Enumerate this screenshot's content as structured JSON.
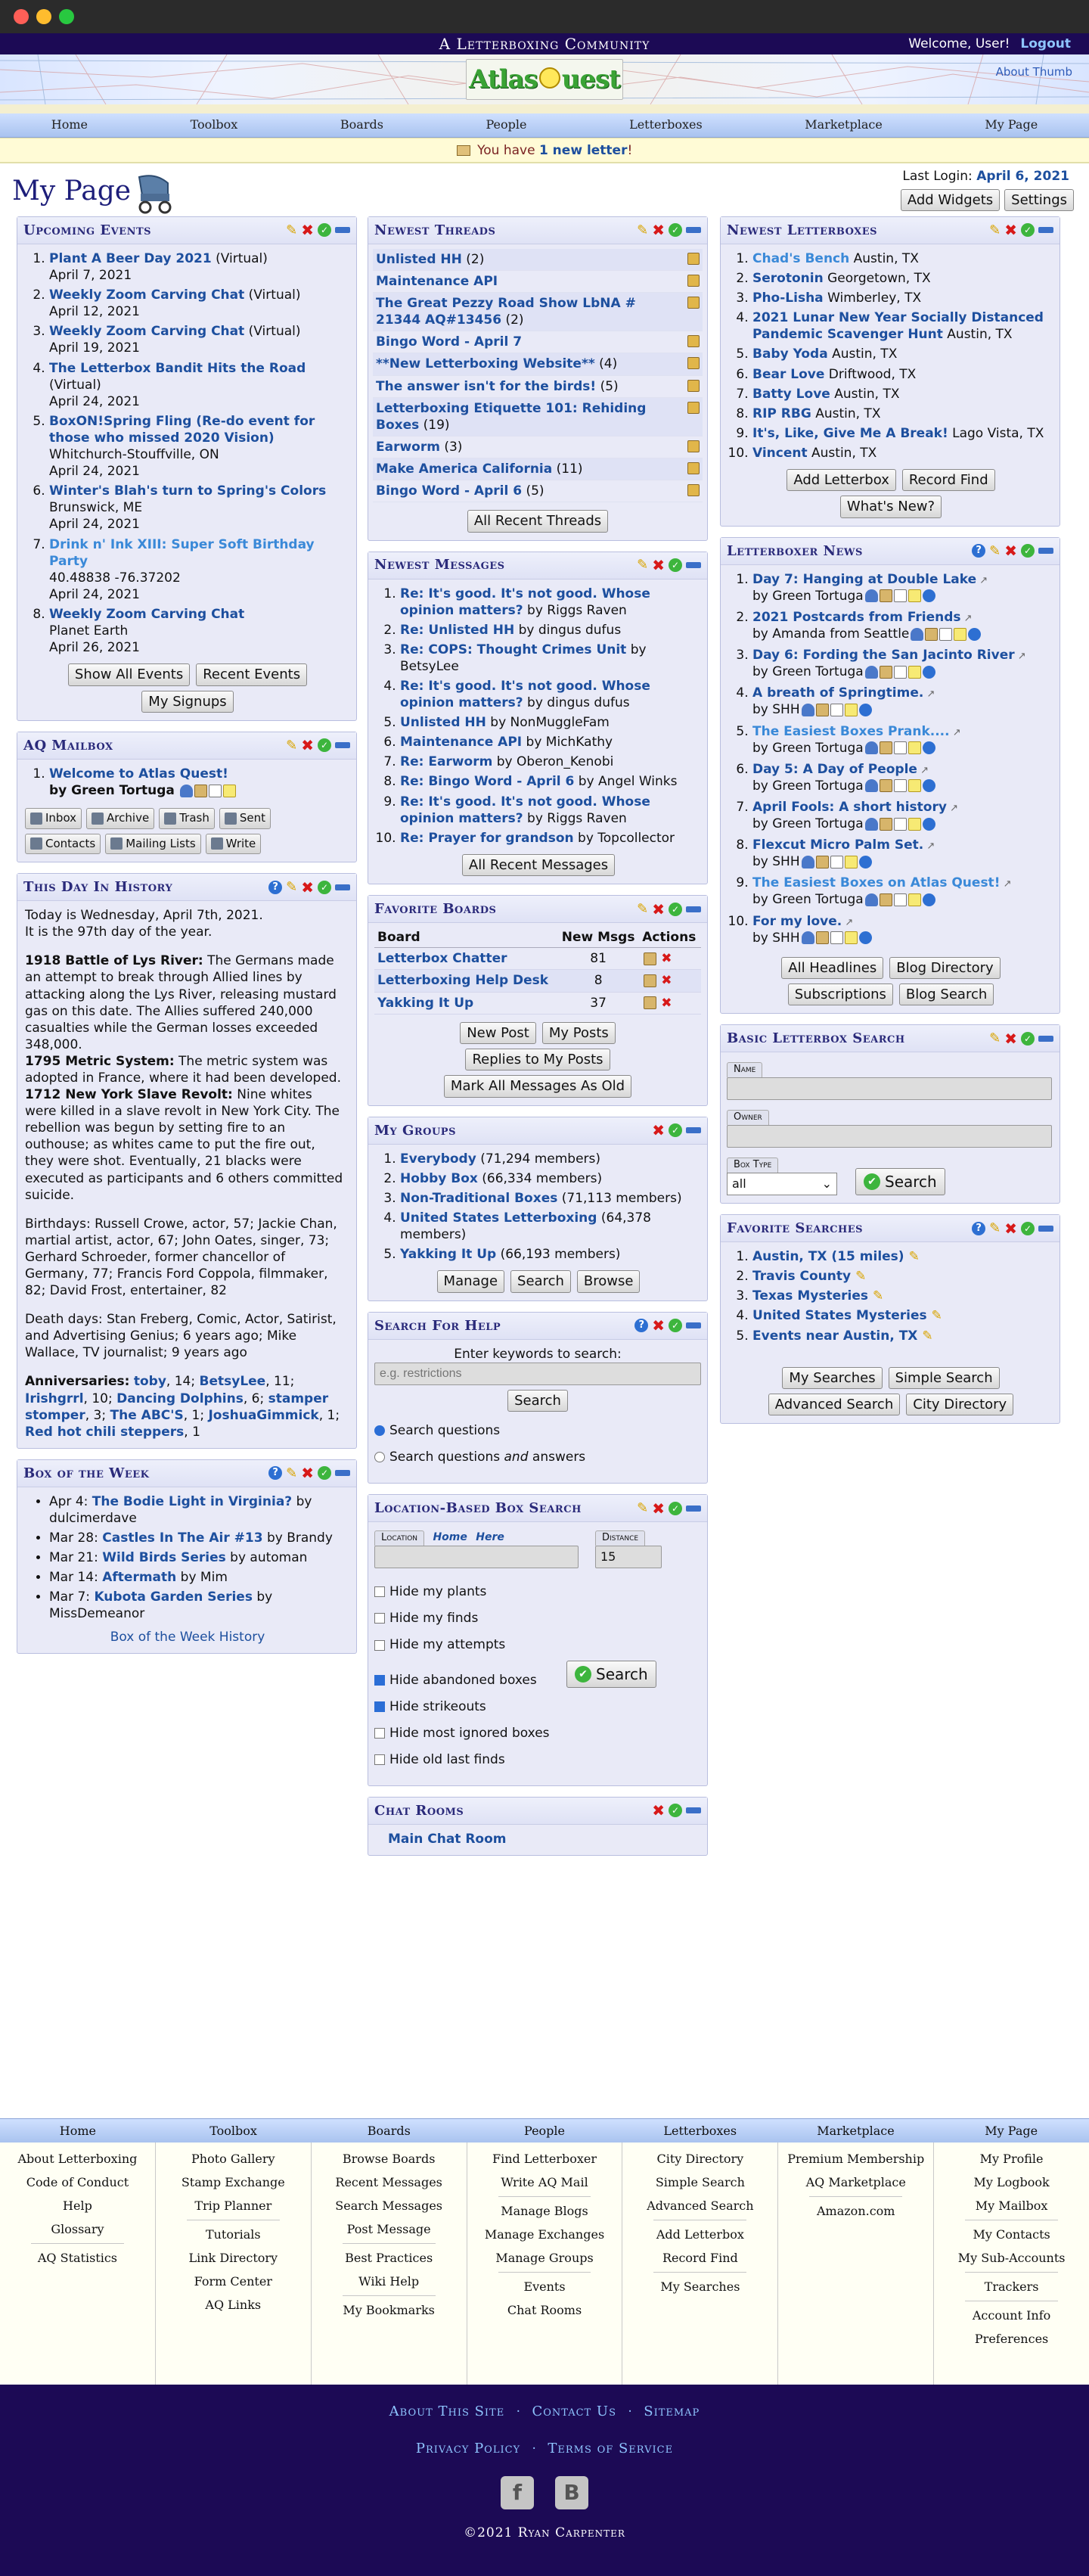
{
  "header": {
    "tagline": "A Letterboxing Community",
    "welcome": "Welcome, User!",
    "logout": "Logout",
    "logo": "AtlasQuest",
    "about": "About Thumb"
  },
  "nav": [
    "Home",
    "Toolbox",
    "Boards",
    "People",
    "Letterboxes",
    "Marketplace",
    "My Page"
  ],
  "notice": {
    "pre": "You have",
    "link": "1 new letter",
    "post": "!"
  },
  "page": {
    "title": "My Page",
    "last_login_label": "Last Login:",
    "last_login": "April 6, 2021",
    "add_widgets": "Add Widgets",
    "settings": "Settings"
  },
  "events": {
    "title": "Upcoming Events",
    "items": [
      {
        "name": "Plant A Beer Day 2021",
        "tag": "(Virtual)",
        "loc": "",
        "date": "April 7, 2021"
      },
      {
        "name": "Weekly Zoom Carving Chat",
        "tag": "(Virtual)",
        "loc": "",
        "date": "April 12, 2021"
      },
      {
        "name": "Weekly Zoom Carving Chat",
        "tag": "(Virtual)",
        "loc": "",
        "date": "April 19, 2021"
      },
      {
        "name": "The Letterbox Bandit Hits the Road",
        "tag": "(Virtual)",
        "loc": "",
        "date": "April 24, 2021"
      },
      {
        "name": "BoxON!Spring Fling (Re-do event for those who missed 2020 Vision)",
        "tag": "",
        "loc": "Whitchurch-Stouffville, ON",
        "date": "April 24, 2021"
      },
      {
        "name": "Winter's Blah's turn to Spring's Colors",
        "tag": "",
        "loc": "Brunswick, ME",
        "date": "April 24, 2021"
      },
      {
        "name": "Drink n' Ink XIII: Super Soft Birthday Party",
        "tag": "",
        "loc": "40.48838 -76.37202",
        "date": "April 24, 2021"
      },
      {
        "name": "Weekly Zoom Carving Chat",
        "tag": "",
        "loc": "Planet Earth",
        "date": "April 26, 2021"
      }
    ],
    "buttons": [
      "Show All Events",
      "Recent Events",
      "My Signups"
    ]
  },
  "mailbox": {
    "title": "AQ Mailbox",
    "item": "Welcome to Atlas Quest!",
    "by": "by Green Tortuga",
    "buttons": [
      "Inbox",
      "Archive",
      "Trash",
      "Sent",
      "Contacts",
      "Mailing Lists",
      "Write"
    ]
  },
  "history": {
    "title": "This Day In History",
    "today": "Today is Wednesday, April 7th, 2021.",
    "dayof": "It is the 97th day of the year.",
    "events": [
      {
        "h": "1918 Battle of Lys River:",
        "t": "The Germans made an attempt to break through Allied lines by attacking along the Lys River, releasing mustard gas on this date. The Allies suffered 240,000 casualties while the German losses exceeded 348,000."
      },
      {
        "h": "1795 Metric System:",
        "t": "The metric system was adopted in France, where it had been developed."
      },
      {
        "h": "1712 New York Slave Revolt:",
        "t": "Nine whites were killed in a slave revolt in New York City. The rebellion was begun by setting fire to an outhouse; as whites came to put the fire out, they were shot. Eventually, 21 blacks were executed as participants and 6 others committed suicide."
      }
    ],
    "birthdays": "Birthdays: Russell Crowe, actor, 57; Jackie Chan, martial artist, actor, 67; John Oates, singer, 73; Gerhard Schroeder, former chancellor of Germany, 77; Francis Ford Coppola, filmmaker, 82; David Frost, entertainer, 82",
    "deaths": "Death days: Stan Freberg, Comic, Actor, Satirist, and Advertising Genius; 6 years ago; Mike Wallace, TV journalist; 9 years ago",
    "anniv_label": "Anniversaries:",
    "anniv": [
      {
        "n": "toby",
        "y": "14"
      },
      {
        "n": "BetsyLee",
        "y": "11"
      },
      {
        "n": "Irishgrrl",
        "y": "10"
      },
      {
        "n": "Dancing Dolphins",
        "y": "6"
      },
      {
        "n": "stamper stomper",
        "y": "3"
      },
      {
        "n": "The ABC'S",
        "y": "1"
      },
      {
        "n": "JoshuaGimmick",
        "y": "1"
      },
      {
        "n": "Red hot chili steppers",
        "y": "1"
      }
    ]
  },
  "botw": {
    "title": "Box of the Week",
    "items": [
      {
        "d": "Apr 4:",
        "n": "The Bodie Light in Virginia?",
        "by": "by dulcimerdave"
      },
      {
        "d": "Mar 28:",
        "n": "Castles In The Air #13",
        "by": "by Brandy"
      },
      {
        "d": "Mar 21:",
        "n": "Wild Birds Series",
        "by": "by automan"
      },
      {
        "d": "Mar 14:",
        "n": "Aftermath",
        "by": "by Mim"
      },
      {
        "d": "Mar 7:",
        "n": "Kubota Garden Series",
        "by": "by MissDemeanor"
      }
    ],
    "history": "Box of the Week History"
  },
  "threads": {
    "title": "Newest Threads",
    "items": [
      {
        "n": "Unlisted HH",
        "c": "(2)"
      },
      {
        "n": "Maintenance API",
        "c": ""
      },
      {
        "n": "The Great Pezzy Road Show LbNA # 21344 AQ#13456",
        "c": "(2)"
      },
      {
        "n": "Bingo Word - April 7",
        "c": ""
      },
      {
        "n": "**New Letterboxing Website**",
        "c": "(4)"
      },
      {
        "n": "The answer isn't for the birds!",
        "c": "(5)"
      },
      {
        "n": "Letterboxing Etiquette 101: Rehiding Boxes",
        "c": "(19)"
      },
      {
        "n": "Earworm",
        "c": "(3)"
      },
      {
        "n": "Make America California",
        "c": "(11)"
      },
      {
        "n": "Bingo Word - April 6",
        "c": "(5)"
      }
    ],
    "button": "All Recent Threads"
  },
  "messages": {
    "title": "Newest Messages",
    "items": [
      {
        "n": "Re: It's good. It's not good. Whose opinion matters?",
        "by": "by Riggs Raven"
      },
      {
        "n": "Re: Unlisted HH",
        "by": "by dingus dufus"
      },
      {
        "n": "Re: COPS: Thought Crimes Unit",
        "by": "by BetsyLee"
      },
      {
        "n": "Re: It's good. It's not good. Whose opinion matters?",
        "by": "by dingus dufus"
      },
      {
        "n": "Unlisted HH",
        "by": "by NonMuggleFam"
      },
      {
        "n": "Maintenance API",
        "by": "by MichKathy"
      },
      {
        "n": "Re: Earworm",
        "by": "by Oberon_Kenobi"
      },
      {
        "n": "Re: Bingo Word - April 6",
        "by": "by Angel Winks"
      },
      {
        "n": "Re: It's good. It's not good. Whose opinion matters?",
        "by": "by Riggs Raven"
      },
      {
        "n": "Re: Prayer for grandson",
        "by": "by Topcollector"
      }
    ],
    "button": "All Recent Messages"
  },
  "boards": {
    "title": "Favorite Boards",
    "cols": [
      "Board",
      "New Msgs",
      "Actions"
    ],
    "rows": [
      {
        "n": "Letterbox Chatter",
        "m": "81"
      },
      {
        "n": "Letterboxing Help Desk",
        "m": "8"
      },
      {
        "n": "Yakking It Up",
        "m": "37"
      }
    ],
    "buttons": [
      "New Post",
      "My Posts",
      "Replies to My Posts",
      "Mark All Messages As Old"
    ]
  },
  "groups": {
    "title": "My Groups",
    "items": [
      {
        "n": "Everybody",
        "c": "(71,294 members)"
      },
      {
        "n": "Hobby Box",
        "c": "(66,334 members)"
      },
      {
        "n": "Non-Traditional Boxes",
        "c": "(71,113 members)"
      },
      {
        "n": "United States Letterboxing",
        "c": "(64,378 members)"
      },
      {
        "n": "Yakking It Up",
        "c": "(66,193 members)"
      }
    ],
    "buttons": [
      "Manage",
      "Search",
      "Browse"
    ]
  },
  "help": {
    "title": "Search For Help",
    "prompt": "Enter keywords to search:",
    "placeholder": "e.g. restrictions",
    "button": "Search",
    "opt1": "Search questions",
    "opt2a": "Search questions ",
    "opt2b": "and",
    "opt2c": " answers"
  },
  "loc": {
    "title": "Location-Based Box Search",
    "location": "Location",
    "home": "Home",
    "here": "Here",
    "distance": "Distance",
    "distval": "15",
    "checks": [
      {
        "l": "Hide my plants",
        "on": false
      },
      {
        "l": "Hide my finds",
        "on": false
      },
      {
        "l": "Hide my attempts",
        "on": false
      },
      {
        "l": "Hide abandoned boxes",
        "on": true
      },
      {
        "l": "Hide strikeouts",
        "on": true
      },
      {
        "l": "Hide most ignored boxes",
        "on": false
      },
      {
        "l": "Hide old last finds",
        "on": false
      }
    ],
    "button": "Search"
  },
  "chat": {
    "title": "Chat Rooms",
    "link": "Main Chat Room"
  },
  "newest": {
    "title": "Newest Letterboxes",
    "items": [
      {
        "n": "Chad's Bench",
        "l": "Austin, TX",
        "light": true
      },
      {
        "n": "Serotonin",
        "l": "Georgetown, TX"
      },
      {
        "n": "Pho-Lisha",
        "l": "Wimberley, TX"
      },
      {
        "n": "2021 Lunar New Year Socially Distanced Pandemic Scavenger Hunt",
        "l": "Austin, TX"
      },
      {
        "n": "Baby Yoda",
        "l": "Austin, TX"
      },
      {
        "n": "Bear Love",
        "l": "Driftwood, TX"
      },
      {
        "n": "Batty Love",
        "l": "Austin, TX"
      },
      {
        "n": "RIP RBG",
        "l": "Austin, TX"
      },
      {
        "n": "It's, Like, Give Me A Break!",
        "l": "Lago Vista, TX"
      },
      {
        "n": "Vincent",
        "l": "Austin, TX"
      }
    ],
    "buttons": [
      "Add Letterbox",
      "Record Find",
      "What's New?"
    ]
  },
  "news": {
    "title": "Letterboxer News",
    "items": [
      {
        "n": "Day 7: Hanging at Double Lake",
        "by": "by Green Tortuga"
      },
      {
        "n": "2021 Postcards from Friends",
        "by": "by Amanda from Seattle"
      },
      {
        "n": "Day 6: Fording the San Jacinto River",
        "by": "by Green Tortuga"
      },
      {
        "n": "A breath of Springtime.",
        "by": "by SHH"
      },
      {
        "n": "The Easiest Boxes Prank....",
        "by": "by Green Tortuga",
        "light": true
      },
      {
        "n": "Day 5: A Day of People",
        "by": "by Green Tortuga"
      },
      {
        "n": "April Fools: A short history",
        "by": "by Green Tortuga"
      },
      {
        "n": "Flexcut Micro Palm Set.",
        "by": "by SHH"
      },
      {
        "n": "The Easiest Boxes on Atlas Quest!",
        "by": "by Green Tortuga",
        "light": true
      },
      {
        "n": "For my love.",
        "by": "by SHH"
      }
    ],
    "buttons": [
      "All Headlines",
      "Blog Directory",
      "Subscriptions",
      "Blog Search"
    ]
  },
  "basic": {
    "title": "Basic Letterbox Search",
    "name": "Name",
    "owner": "Owner",
    "type": "Box Type",
    "typeval": "all",
    "button": "Search"
  },
  "favs": {
    "title": "Favorite Searches",
    "items": [
      "Austin, TX (15 miles)",
      "Travis County",
      "Texas Mysteries",
      "United States Mysteries",
      "Events near Austin, TX"
    ],
    "buttons": [
      "My Searches",
      "Simple Search",
      "Advanced Search",
      "City Directory"
    ]
  },
  "footer": {
    "cols": [
      {
        "h": "Home",
        "g": [
          [
            "About Letterboxing",
            "Code of Conduct",
            "Help",
            "Glossary"
          ],
          [
            "AQ Statistics"
          ]
        ]
      },
      {
        "h": "Toolbox",
        "g": [
          [
            "Photo Gallery",
            "Stamp Exchange",
            "Trip Planner"
          ],
          [
            "Tutorials",
            "Link Directory",
            "Form Center",
            "AQ Links"
          ]
        ]
      },
      {
        "h": "Boards",
        "g": [
          [
            "Browse Boards",
            "Recent Messages",
            "Search Messages",
            "Post Message"
          ],
          [
            "Best Practices",
            "Wiki Help"
          ],
          [
            "My Bookmarks"
          ]
        ]
      },
      {
        "h": "People",
        "g": [
          [
            "Find Letterboxer",
            "Write AQ Mail"
          ],
          [
            "Manage Blogs",
            "Manage Exchanges",
            "Manage Groups"
          ],
          [
            "Events",
            "Chat Rooms"
          ]
        ]
      },
      {
        "h": "Letterboxes",
        "g": [
          [
            "City Directory",
            "Simple Search",
            "Advanced Search"
          ],
          [
            "Add Letterbox",
            "Record Find"
          ],
          [
            "My Searches"
          ]
        ]
      },
      {
        "h": "Marketplace",
        "g": [
          [
            "Premium Membership",
            "AQ Marketplace"
          ],
          [
            "Amazon.com"
          ]
        ]
      },
      {
        "h": "My Page",
        "g": [
          [
            "My Profile",
            "My Logbook",
            "My Mailbox"
          ],
          [
            "My Contacts",
            "My Sub-Accounts"
          ],
          [
            "Trackers"
          ],
          [
            "Account Info",
            "Preferences"
          ]
        ]
      }
    ],
    "links": [
      "About This Site",
      "Contact Us",
      "Sitemap"
    ],
    "links2": [
      "Privacy Policy",
      "Terms of Service"
    ],
    "copyright": "©2021 Ryan Carpenter"
  },
  "colors": {
    "header": "#1c0a55",
    "panel": "#e9eaf7",
    "link": "#1d4f9e",
    "title": "#2a2a7a"
  }
}
